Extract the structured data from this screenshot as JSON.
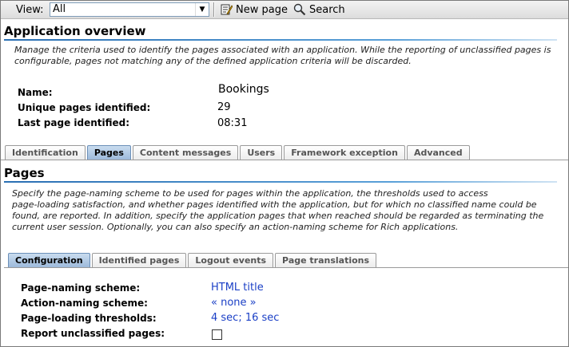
{
  "toolbar": {
    "view_label": "View:",
    "view_value": "All",
    "new_page_label": "New page",
    "search_label": "Search"
  },
  "app_overview": {
    "title": "Application overview",
    "description": "Manage the criteria used to identify the pages associated with an application. While the reporting of unclassified pages is configurable, pages not matching any of the defined application criteria will be discarded.",
    "description_lines": [
      "Manage the criteria used to identify the pages associated with an application. While the reporting of unclassified pages is",
      "configurable, pages not matching any of the defined application criteria will be discarded."
    ],
    "fields": [
      {
        "label": "Name:",
        "value": "Bookings"
      },
      {
        "label": "Unique pages identified:",
        "value": "29"
      },
      {
        "label": "Last page identified:",
        "value": "08:31"
      }
    ]
  },
  "main_tabs": [
    "Identification",
    "Pages",
    "Content messages",
    "Users",
    "Framework exception",
    "Advanced"
  ],
  "main_tabs_active": "Pages",
  "pages": {
    "title": "Pages",
    "description_lines": [
      "Specify the page-naming scheme to be used for pages within the application, the thresholds used to access",
      "page-loading satisfaction, and whether pages identified with the application, but for which no classified name could be",
      "found, are reported. In addition, specify the application pages that when reached should be regarded as terminating the",
      "current user session. Optionally, you can also specify an action-naming scheme for Rich applications."
    ]
  },
  "sub_tabs": [
    "Configuration",
    "Identified pages",
    "Logout events",
    "Page translations"
  ],
  "sub_tabs_active": "Configuration",
  "config": {
    "page_naming_label": "Page-naming scheme:",
    "page_naming_value": "HTML title",
    "action_naming_label": "Action-naming scheme:",
    "action_naming_value": "« none »",
    "thresholds_label": "Page-loading thresholds:",
    "thresholds_value": "4 sec; 16 sec",
    "report_unclassified_label": "Report unclassified pages:",
    "report_unclassified_checked": false
  },
  "colors": {
    "link": "#1a3fc6",
    "accent": "#2a6fb3",
    "active_tab": "#9dbadb"
  }
}
